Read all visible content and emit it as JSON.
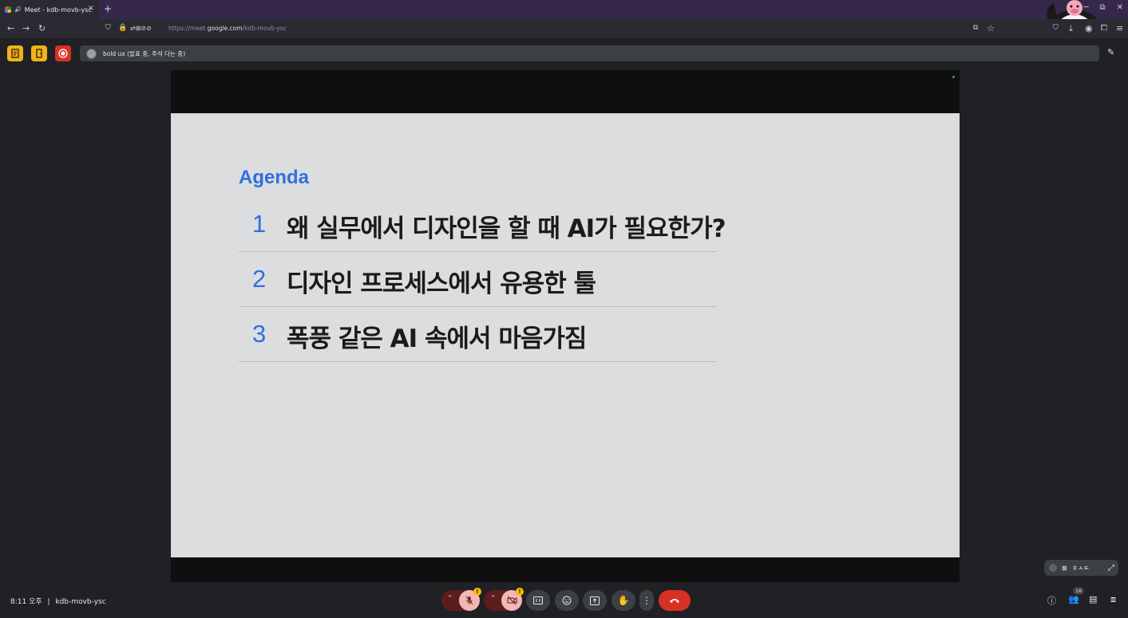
{
  "browser": {
    "tab_title": "Meet - kdb-movb-ysc",
    "url_prefix": "https://meet.",
    "url_domain": "google.com",
    "url_path": "/kdb-movb-ysc"
  },
  "meeting": {
    "presentation_title": "bold ux (발표 중, 주석 다는 중)",
    "time": "8:11 오후",
    "separator": "|",
    "meeting_code": "kdb-movb-ysc",
    "participant_count": "16",
    "mic_warning": "!",
    "cam_warning": "!",
    "self_tile_label": "ㅎㅅㅌ"
  },
  "slide": {
    "title": "Agenda",
    "items": [
      {
        "num": "1",
        "text": "왜 실무에서 디자인을 할 때 AI가 필요한가?"
      },
      {
        "num": "2",
        "text": "디자인 프로세스에서 유용한 툴"
      },
      {
        "num": "3",
        "text": "폭풍 같은 AI 속에서 마음가짐"
      }
    ]
  },
  "colors": {
    "accent_blue": "#2f6fe0",
    "end_call_red": "#d93025",
    "ext_yellow": "#f1b21c",
    "ext_red": "#d93025"
  }
}
